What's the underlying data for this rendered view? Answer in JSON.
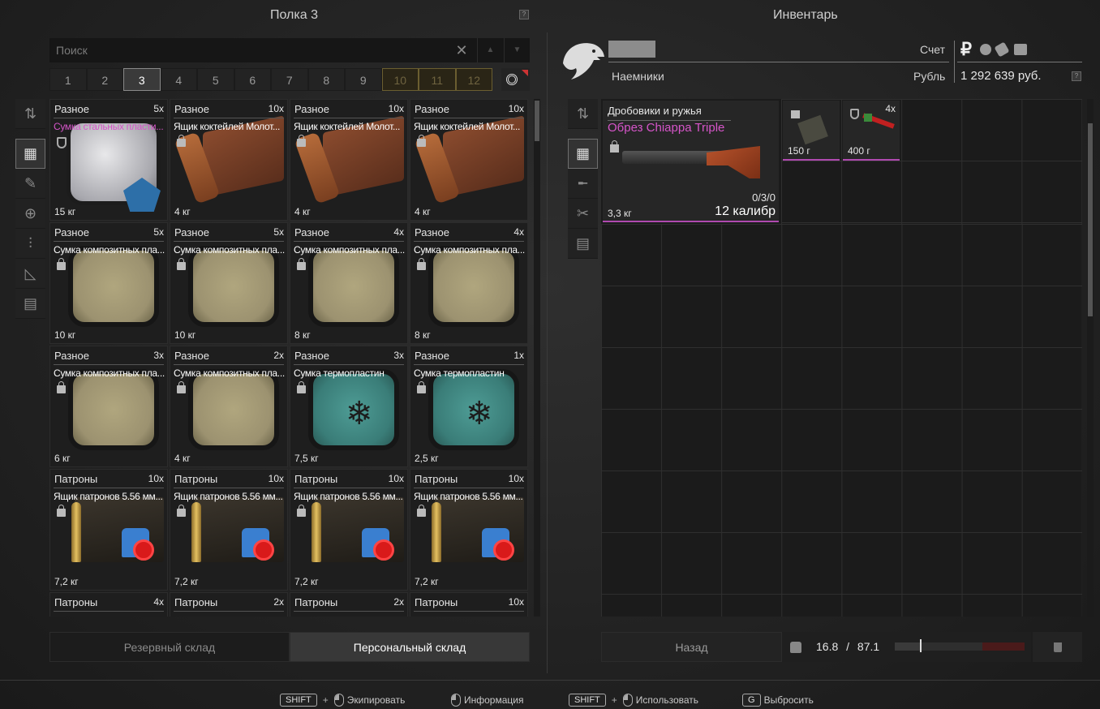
{
  "left_panel": {
    "title": "Полка 3",
    "help": "?",
    "search": {
      "placeholder": "Поиск",
      "value": ""
    },
    "shelf_tabs": [
      {
        "label": "1",
        "state": "normal"
      },
      {
        "label": "2",
        "state": "normal"
      },
      {
        "label": "3",
        "state": "active"
      },
      {
        "label": "4",
        "state": "normal"
      },
      {
        "label": "5",
        "state": "normal"
      },
      {
        "label": "6",
        "state": "normal"
      },
      {
        "label": "7",
        "state": "normal"
      },
      {
        "label": "8",
        "state": "normal"
      },
      {
        "label": "9",
        "state": "normal"
      },
      {
        "label": "10",
        "state": "locked"
      },
      {
        "label": "11",
        "state": "locked"
      },
      {
        "label": "12",
        "state": "locked"
      }
    ],
    "items": [
      {
        "category": "Разное",
        "qty": "5x",
        "name": "Сумка стальных пласти...",
        "weight": "15 кг",
        "kind": "steel",
        "rare": true,
        "mark": "shield"
      },
      {
        "category": "Разное",
        "qty": "10x",
        "name": "Ящик коктейлей Молот...",
        "weight": "4 кг",
        "kind": "wood"
      },
      {
        "category": "Разное",
        "qty": "10x",
        "name": "Ящик коктейлей Молот...",
        "weight": "4 кг",
        "kind": "wood"
      },
      {
        "category": "Разное",
        "qty": "10x",
        "name": "Ящик коктейлей Молот...",
        "weight": "4 кг",
        "kind": "wood"
      },
      {
        "category": "Разное",
        "qty": "5x",
        "name": "Сумка композитных пла...",
        "weight": "10 кг",
        "kind": "comp"
      },
      {
        "category": "Разное",
        "qty": "5x",
        "name": "Сумка композитных пла...",
        "weight": "10 кг",
        "kind": "comp"
      },
      {
        "category": "Разное",
        "qty": "4x",
        "name": "Сумка композитных пла...",
        "weight": "8 кг",
        "kind": "comp"
      },
      {
        "category": "Разное",
        "qty": "4x",
        "name": "Сумка композитных пла...",
        "weight": "8 кг",
        "kind": "comp"
      },
      {
        "category": "Разное",
        "qty": "3x",
        "name": "Сумка композитных пла...",
        "weight": "6 кг",
        "kind": "comp"
      },
      {
        "category": "Разное",
        "qty": "2x",
        "name": "Сумка композитных пла...",
        "weight": "4 кг",
        "kind": "comp"
      },
      {
        "category": "Разное",
        "qty": "3x",
        "name": "Сумка термопластин",
        "weight": "7,5 кг",
        "kind": "cold"
      },
      {
        "category": "Разное",
        "qty": "1x",
        "name": "Сумка термопластин",
        "weight": "2,5 кг",
        "kind": "cold"
      },
      {
        "category": "Патроны",
        "qty": "10x",
        "name": "Ящик патронов 5.56 мм...",
        "weight": "7,2 кг",
        "kind": "ammo"
      },
      {
        "category": "Патроны",
        "qty": "10x",
        "name": "Ящик патронов 5.56 мм...",
        "weight": "7,2 кг",
        "kind": "ammo"
      },
      {
        "category": "Патроны",
        "qty": "10x",
        "name": "Ящик патронов 5.56 мм...",
        "weight": "7,2 кг",
        "kind": "ammo"
      },
      {
        "category": "Патроны",
        "qty": "10x",
        "name": "Ящик патронов 5.56 мм...",
        "weight": "7,2 кг",
        "kind": "ammo"
      },
      {
        "category": "Патроны",
        "qty": "4x",
        "name": "",
        "weight": "",
        "kind": "none"
      },
      {
        "category": "Патроны",
        "qty": "2x",
        "name": "",
        "weight": "",
        "kind": "none"
      },
      {
        "category": "Патроны",
        "qty": "2x",
        "name": "",
        "weight": "",
        "kind": "none"
      },
      {
        "category": "Патроны",
        "qty": "10x",
        "name": "",
        "weight": "",
        "kind": "none"
      }
    ],
    "stash_tabs": [
      {
        "label": "Резервный склад",
        "active": false
      },
      {
        "label": "Персональный склад",
        "active": true
      }
    ]
  },
  "right_panel": {
    "title": "Инвентарь",
    "faction": "Наемники",
    "account_label": "Счет",
    "currency_label": "Рубль",
    "currency_symbol": "₽",
    "balance": "1 292 639 руб.",
    "help": "?",
    "main_item": {
      "category": "Дробовики и ружья",
      "name": "Обрез Chiappa Triple",
      "ammo": "0/3/0",
      "caliber": "12 калибр",
      "weight": "3,3 кг"
    },
    "small_items": [
      {
        "weight": "150 г",
        "qty": "",
        "mark": "lock"
      },
      {
        "weight": "400 г",
        "qty": "4x",
        "mark": "shield"
      }
    ],
    "back_label": "Назад",
    "weight_current": "16.8",
    "weight_sep": "/",
    "weight_max": "87.1",
    "weight_fraction": 0.193
  },
  "footer": {
    "hints": [
      {
        "key": "SHIFT",
        "plus": "+",
        "label": "Экипировать"
      },
      {
        "key": "",
        "plus": "",
        "label": "Информация"
      },
      {
        "key": "SHIFT",
        "plus": "+",
        "label": "Использовать"
      },
      {
        "key": "G",
        "plus": "",
        "label": "Выбросить"
      }
    ]
  }
}
